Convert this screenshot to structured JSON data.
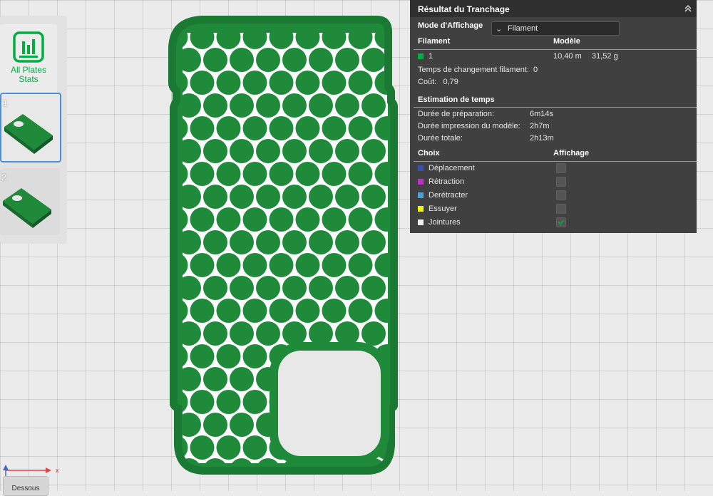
{
  "sidebar": {
    "all_stats_label_1": "All Plates",
    "all_stats_label_2": "Stats",
    "plates": [
      {
        "number": "1",
        "selected": true
      },
      {
        "number": "2",
        "selected": false
      }
    ]
  },
  "panel": {
    "title": "Résultat du Tranchage",
    "mode_label": "Mode d'Affichage",
    "mode_value": "Filament",
    "col_filament": "Filament",
    "col_model": "Modèle",
    "filament_id": "1",
    "filament_color": "#00ae42",
    "filament_length": "10,40 m",
    "filament_weight": "31,52 g",
    "change_time_label": "Temps de changement filament:",
    "change_time_value": "0",
    "cost_label": "Coût:",
    "cost_value": "0,79",
    "time_section": "Estimation de temps",
    "prep_label": "Durée de préparation:",
    "prep_value": "6m14s",
    "print_label": "Durée impression du modèle:",
    "print_value": "2h7m",
    "total_label": "Durée totale:",
    "total_value": "2h13m",
    "col_choice": "Choix",
    "col_display": "Affichage",
    "options": [
      {
        "label": "Déplacement",
        "color": "#3a4fb0",
        "checked": false
      },
      {
        "label": "Rétraction",
        "color": "#c02fc8",
        "checked": false
      },
      {
        "label": "Derétracter",
        "color": "#4aa3d8",
        "checked": false
      },
      {
        "label": "Essuyer",
        "color": "#f2f21a",
        "checked": false
      },
      {
        "label": "Jointures",
        "color": "#f0f0f0",
        "checked": true
      }
    ]
  },
  "viewport": {
    "model_color": "#1e8a3a",
    "axis_x_label": "x",
    "view_button": "Dessous"
  }
}
